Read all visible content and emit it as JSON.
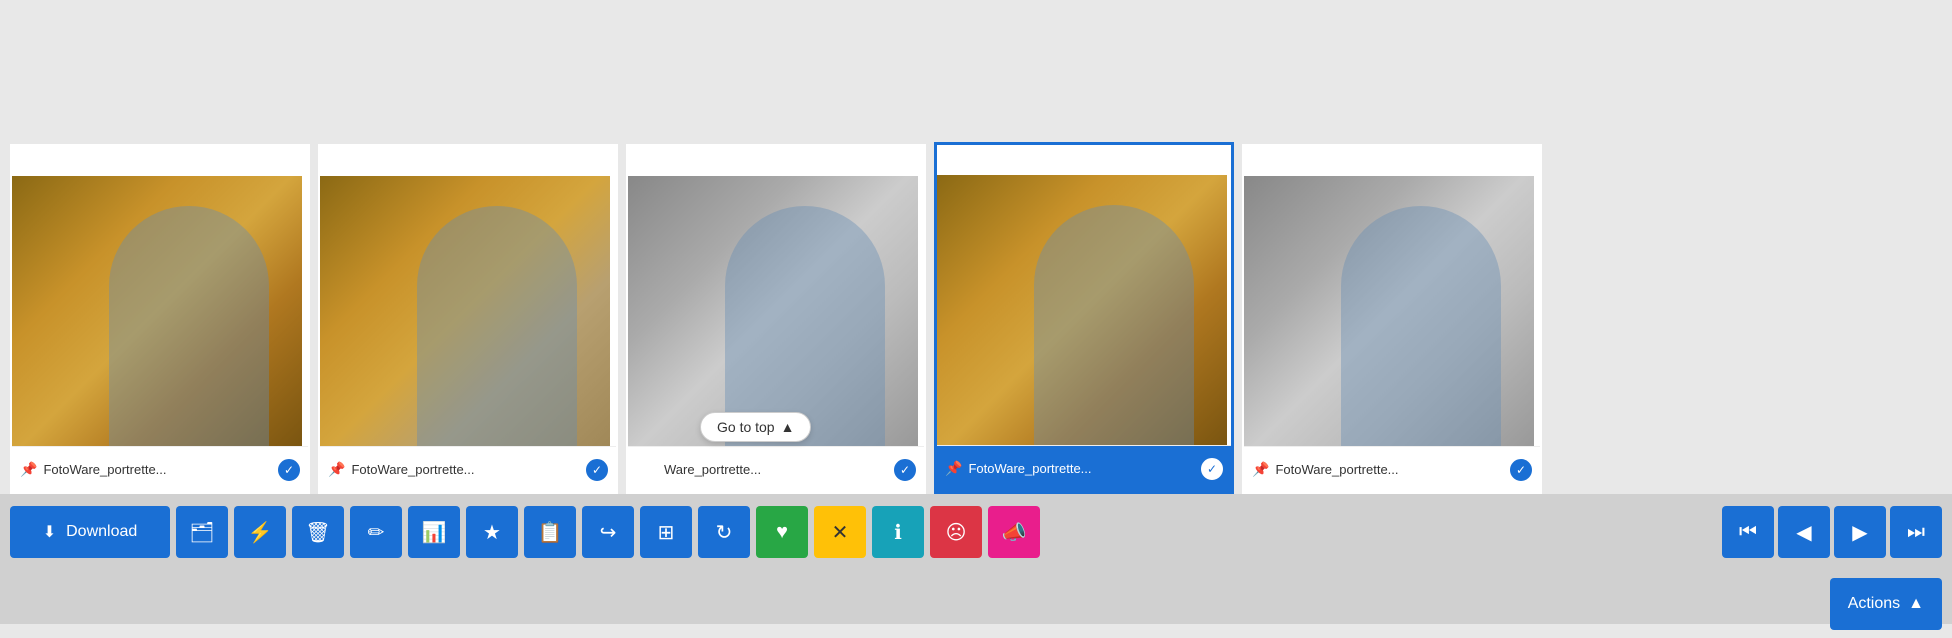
{
  "gallery": {
    "cards": [
      {
        "id": 1,
        "filename": "FotoWare_portrette...",
        "selected": false,
        "checked": true,
        "color_type": "color"
      },
      {
        "id": 2,
        "filename": "FotoWare_portrette...",
        "selected": false,
        "checked": true,
        "color_type": "color"
      },
      {
        "id": 3,
        "filename": "Ware_portrette...",
        "selected": false,
        "checked": true,
        "color_type": "bw"
      },
      {
        "id": 4,
        "filename": "FotoWare_portrette...",
        "selected": true,
        "checked": true,
        "color_type": "color"
      },
      {
        "id": 5,
        "filename": "FotoWare_portrette...",
        "selected": false,
        "checked": true,
        "color_type": "bw"
      }
    ],
    "go_to_top_label": "Go to top"
  },
  "toolbar": {
    "download_label": "Download",
    "actions_label": "Actions",
    "icons": {
      "download": "⬇",
      "briefcase": "💼",
      "share": "⚡",
      "trash": "🗑",
      "edit": "✏",
      "chart": "📊",
      "star": "★",
      "copy": "📋",
      "export": "↪",
      "crop": "⊞",
      "refresh": "↻",
      "heart": "♥",
      "close": "✕",
      "info": "ℹ",
      "face": "☹",
      "megaphone": "📣",
      "first": "⏮",
      "prev": "◀",
      "next": "▶",
      "last": "⏭",
      "chevron_up": "▲",
      "pin": "📌"
    }
  }
}
